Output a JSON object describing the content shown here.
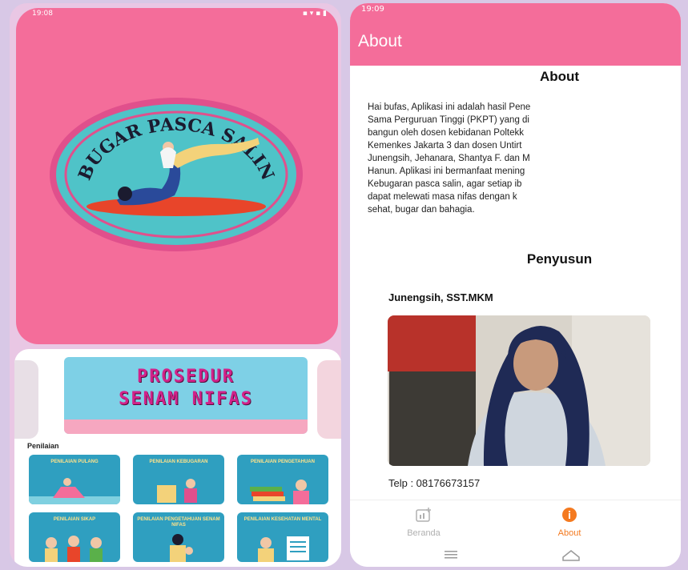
{
  "left_screen": {
    "status_time": "19:08",
    "status_icons": "▪ ▾ ▪ ▮",
    "logo_text": "BUGAR PASCA SALIN",
    "banner": {
      "line1": "PROSEDUR",
      "line2": "SENAM NIFAS"
    },
    "section_label": "Penilaian",
    "tiles": [
      {
        "label": "Penilaian Pulang"
      },
      {
        "label": "Penilaian Kebugaran"
      },
      {
        "label": "Penilaian Pengetahuan"
      },
      {
        "label": "Penilaian Sikap"
      },
      {
        "label": "Penilaian Pengetahuan Senam Nifas"
      },
      {
        "label": "Penilaian Kesehatan Mental"
      }
    ]
  },
  "right_screen": {
    "status_time": "19:09",
    "appbar_title": "About",
    "about_heading": "About",
    "about_lines": [
      "Hai bufas, Aplikasi ini adalah hasil Pene",
      "Sama Perguruan Tinggi (PKPT) yang di",
      "bangun oleh dosen kebidanan Poltekk",
      "Kemenkes Jakarta 3 dan  dosen Untirt",
      "Junengsih, Jehanara, Shantya F. dan M",
      "Hanun. Aplikasi ini bermanfaat mening",
      "Kebugaran pasca salin, agar setiap ib",
      "dapat melewati masa nifas dengan k",
      "sehat, bugar dan bahagia."
    ],
    "penyusun_heading": "Penyusun",
    "author_name": "Junengsih, SST.MKM",
    "telp": "Telp : 08176673157",
    "nav": {
      "beranda_label": "Beranda",
      "about_label": "About",
      "about_badge": "i"
    }
  },
  "colors": {
    "brand_pink": "#f46d9a",
    "tile_blue": "#2f9fc0",
    "active_orange": "#f47a20"
  }
}
